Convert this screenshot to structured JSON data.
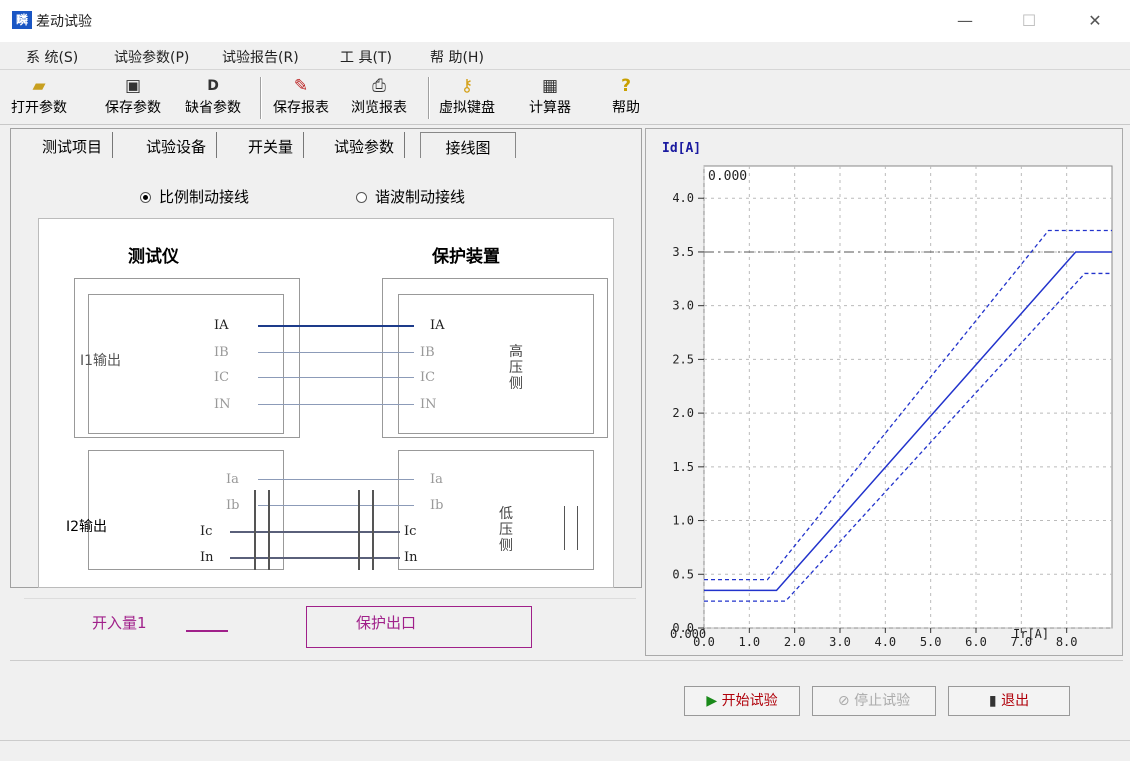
{
  "window": {
    "title": "差动试验",
    "icon_text": "疄",
    "controls": [
      "—",
      "☐",
      "✕"
    ]
  },
  "menu": [
    "系 统(S)",
    "试验参数(P)",
    "试验报告(R)",
    "工 具(T)",
    "帮 助(H)"
  ],
  "toolbar": {
    "buttons": [
      {
        "label": "打开参数",
        "icon": "open-folder-icon"
      },
      {
        "label": "保存参数",
        "icon": "floppy-disk-icon"
      },
      {
        "label": "缺省参数",
        "icon": "default-d-icon"
      },
      {
        "label": "保存报表",
        "icon": "excel-report-icon"
      },
      {
        "label": "浏览报表",
        "icon": "printer-icon"
      },
      {
        "label": "虚拟键盘",
        "icon": "key-icon"
      },
      {
        "label": "计算器",
        "icon": "calculator-icon"
      },
      {
        "label": "帮助",
        "icon": "question-mark-icon"
      }
    ]
  },
  "tabs": [
    "测试项目",
    "试验设备",
    "开关量",
    "试验参数",
    "接线图"
  ],
  "active_tab": "接线图",
  "radios": {
    "option1": "比例制动接线",
    "option2": "谐波制动接线",
    "selected": "比例制动接线"
  },
  "wiring": {
    "left_header": "测试仪",
    "right_header": "保护装置",
    "i1_label": "I1输出",
    "i2_label": "I2输出",
    "i1_pins": [
      "IA",
      "IB",
      "IC",
      "IN"
    ],
    "i2_pins": [
      "Ia",
      "Ib",
      "Ic",
      "In"
    ],
    "right_i1_pins": [
      "IA",
      "IB",
      "IC",
      "IN"
    ],
    "right_i2_pins": [
      "Ia",
      "Ib",
      "Ic",
      "In"
    ],
    "high_side": "高压侧",
    "low_side": "低压侧",
    "binary_in": "开入量1",
    "protect_out": "保护出口"
  },
  "chart_data": {
    "type": "line",
    "ylabel": "Id[A]",
    "xlabel": "Ir[A]",
    "readout_top": "0.000",
    "readout_bottom": "0.000",
    "yticks": [
      "4.0",
      "3.5",
      "3.0",
      "2.5",
      "2.0",
      "1.5",
      "1.0",
      "0.5",
      "0.0"
    ],
    "xticks": [
      "0.0",
      "1.0",
      "2.0",
      "3.0",
      "4.0",
      "5.0",
      "6.0",
      "7.0",
      "8.0"
    ],
    "xlim": [
      0,
      9
    ],
    "ylim": [
      0,
      4.3
    ],
    "series": [
      {
        "x": [
          0,
          1.6,
          8.2,
          9.0
        ],
        "y": [
          0.35,
          0.35,
          3.5,
          3.5
        ],
        "style": "solid"
      },
      {
        "x": [
          0,
          1.4,
          7.6,
          9.0
        ],
        "y": [
          0.45,
          0.45,
          3.7,
          3.7
        ],
        "style": "dashed"
      },
      {
        "x": [
          0,
          1.8,
          8.4,
          9.0
        ],
        "y": [
          0.25,
          0.25,
          3.3,
          3.3
        ],
        "style": "dashed"
      }
    ],
    "hline": {
      "y": 3.5,
      "style": "dashdot"
    }
  },
  "buttons": {
    "start": "开始试验",
    "stop": "停止试验",
    "exit": "退出"
  }
}
